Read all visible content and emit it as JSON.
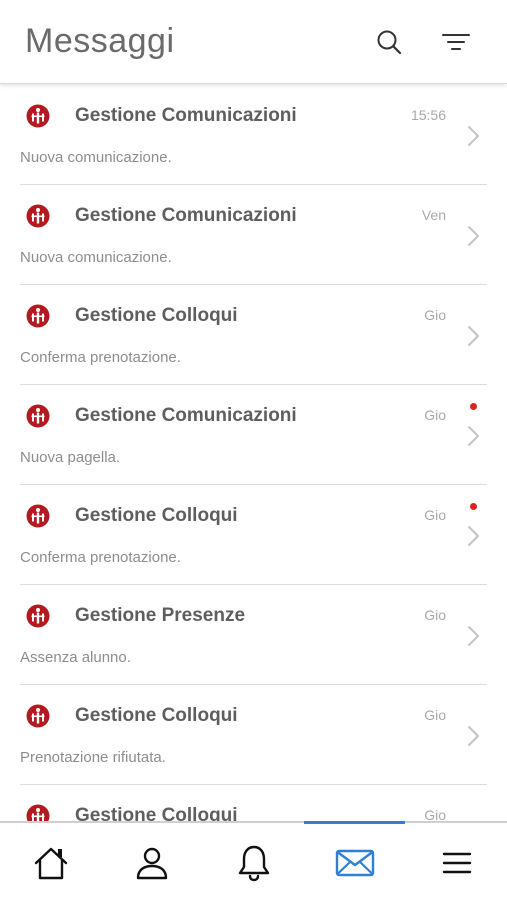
{
  "header": {
    "title": "Messaggi",
    "search_icon": "search-icon",
    "filter_icon": "filter-icon"
  },
  "messages": [
    {
      "sender": "Gestione Comunicazioni",
      "time": "15:56",
      "preview": "Nuova comunicazione.",
      "unread": false
    },
    {
      "sender": "Gestione Comunicazioni",
      "time": "Ven",
      "preview": "Nuova comunicazione.",
      "unread": false
    },
    {
      "sender": "Gestione Colloqui",
      "time": "Gio",
      "preview": "Conferma prenotazione.",
      "unread": false
    },
    {
      "sender": "Gestione Comunicazioni",
      "time": "Gio",
      "preview": "Nuova pagella.",
      "unread": true
    },
    {
      "sender": "Gestione Colloqui",
      "time": "Gio",
      "preview": "Conferma prenotazione.",
      "unread": true
    },
    {
      "sender": "Gestione Presenze",
      "time": "Gio",
      "preview": "Assenza alunno.",
      "unread": false
    },
    {
      "sender": "Gestione Colloqui",
      "time": "Gio",
      "preview": "Prenotazione rifiutata.",
      "unread": false
    },
    {
      "sender": "Gestione Colloqui",
      "time": "Gio",
      "preview": "",
      "unread": false
    }
  ],
  "tabbar": {
    "items": [
      "home-icon",
      "profile-icon",
      "bell-icon",
      "mail-icon",
      "menu-icon"
    ],
    "active": "mail-icon"
  },
  "colors": {
    "accent": "#2f7fd6",
    "brand_red": "#b3191f",
    "unread_dot": "#e0201c",
    "title_gray": "#6a6a6a"
  }
}
